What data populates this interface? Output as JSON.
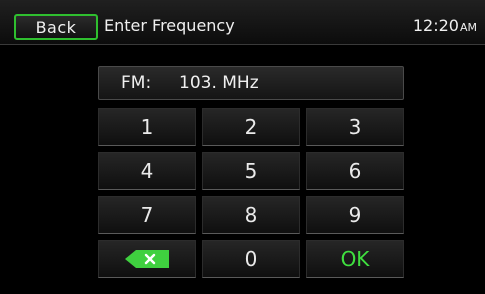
{
  "header": {
    "back_label": "Back",
    "title": "Enter Frequency",
    "time": "12:20",
    "ampm": "AM"
  },
  "display": {
    "band": "FM:",
    "frequency": "103. MHz"
  },
  "keypad": {
    "keys": [
      "1",
      "2",
      "3",
      "4",
      "5",
      "6",
      "7",
      "8",
      "9",
      "0"
    ],
    "ok_label": "OK",
    "backspace_icon": "backspace-icon"
  },
  "colors": {
    "accent_green": "#2fbf2f",
    "ok_green": "#3fe03f"
  }
}
